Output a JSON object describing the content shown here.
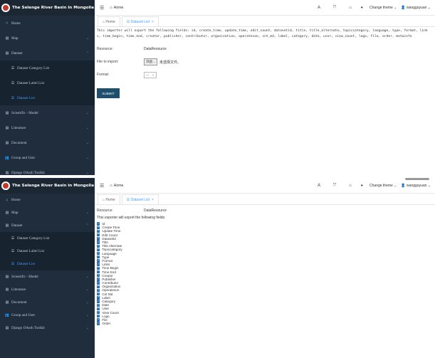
{
  "app": {
    "title": "The Selenge River Basin in Mongolia Admin"
  },
  "sidebar": {
    "items": [
      {
        "label": "Home",
        "icon": "home-icon"
      },
      {
        "label": "Map",
        "icon": "map-icon"
      },
      {
        "label": "Dataset",
        "icon": "dataset-icon"
      },
      {
        "label": "Dataset Category List",
        "icon": "list-icon"
      },
      {
        "label": "Dataset Label List",
        "icon": "list-icon"
      },
      {
        "label": "Dataset List",
        "icon": "list-icon"
      },
      {
        "label": "Scientific - Model",
        "icon": "grid-icon"
      },
      {
        "label": "Literature",
        "icon": "grid-icon"
      },
      {
        "label": "Document",
        "icon": "grid-icon"
      },
      {
        "label": "Group and User",
        "icon": "users-icon"
      },
      {
        "label": "Django OAuth Toolkit",
        "icon": "grid-icon"
      }
    ],
    "active_color": "#409eff"
  },
  "header": {
    "breadcrumb": "Home",
    "theme_label": "Change theme",
    "user": "wangguyuan"
  },
  "tabs": [
    {
      "label": "Home"
    },
    {
      "label": "Dataset List"
    }
  ],
  "screen1": {
    "notice": "This importer will export the following fields: id, create_time, update_time, edit_count, datasetid, title, title_alternate, topiccategory, language, type, format, links, time_begin, time_end, creator, publisher, contributor, organization, operateson, cnt_md, label, category, date, user, view_count, logo, file, order, metainfo",
    "resource_label": "Resource:",
    "resource_value": "DataResource",
    "file_label": "File to import:",
    "file_button": "浏览...",
    "file_status": "未选择文件。",
    "format_label": "Format:",
    "format_value": "---",
    "submit_label": "SUBMIT"
  },
  "screen2": {
    "resource_label": "Resource:",
    "resource_value": "DataResource",
    "fields_intro": "This exporter will export the following fields:",
    "fields": [
      "Id",
      "Create Time",
      "Update Time",
      "Edit Count",
      "Datasetid",
      "Title",
      "Title Alternate",
      "Topiccategory",
      "Language",
      "Type",
      "Format",
      "Links",
      "Time Begin",
      "Time End",
      "Creator",
      "Publisher",
      "Contributor",
      "Organization",
      "Operateson",
      "Cnt Md",
      "Label",
      "Category",
      "Date",
      "User",
      "View Count",
      "Logo",
      "File",
      "Order"
    ]
  }
}
